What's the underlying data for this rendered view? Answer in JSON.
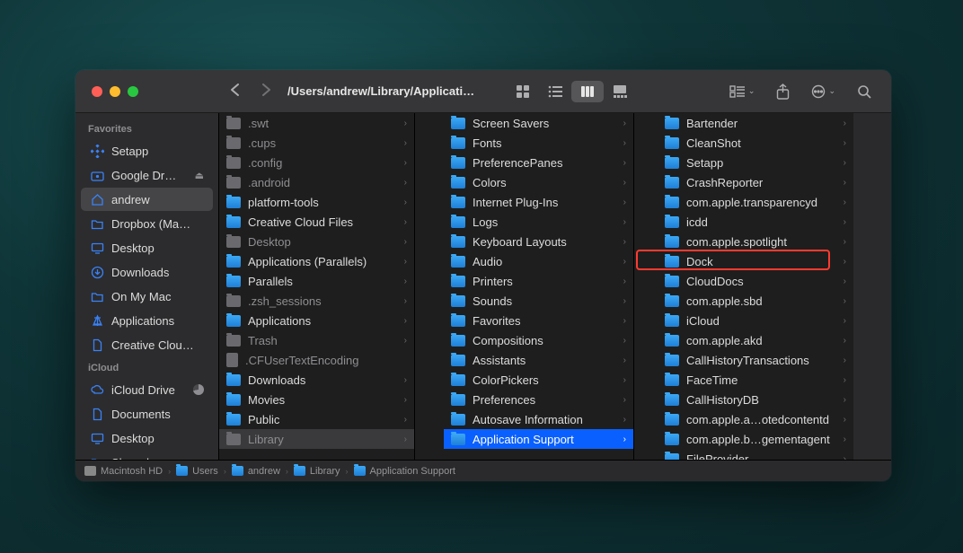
{
  "window": {
    "title": "/Users/andrew/Library/Applicati…"
  },
  "sidebar": {
    "section_favorites": "Favorites",
    "section_icloud": "iCloud",
    "favorites": [
      {
        "label": "Setapp",
        "icon": "setapp"
      },
      {
        "label": "Google Dr…",
        "icon": "drive",
        "eject": true
      },
      {
        "label": "andrew",
        "icon": "home",
        "active": true
      },
      {
        "label": "Dropbox (Ma…",
        "icon": "folder"
      },
      {
        "label": "Desktop",
        "icon": "desktop"
      },
      {
        "label": "Downloads",
        "icon": "downloads"
      },
      {
        "label": "On My Mac",
        "icon": "folder"
      },
      {
        "label": "Applications",
        "icon": "apps"
      },
      {
        "label": "Creative Clou…",
        "icon": "doc"
      }
    ],
    "icloud": [
      {
        "label": "iCloud Drive",
        "icon": "cloud",
        "pie": true
      },
      {
        "label": "Documents",
        "icon": "doc"
      },
      {
        "label": "Desktop",
        "icon": "desktop"
      },
      {
        "label": "Shared",
        "icon": "shared"
      }
    ]
  },
  "col1": [
    {
      "label": ".swt",
      "dim": true
    },
    {
      "label": ".cups",
      "dim": true
    },
    {
      "label": ".config",
      "dim": true
    },
    {
      "label": ".android",
      "dim": true
    },
    {
      "label": "platform-tools"
    },
    {
      "label": "Creative Cloud Files"
    },
    {
      "label": "Desktop",
      "dim": true
    },
    {
      "label": "Applications (Parallels)"
    },
    {
      "label": "Parallels"
    },
    {
      "label": ".zsh_sessions",
      "dim": true
    },
    {
      "label": "Applications"
    },
    {
      "label": "Trash",
      "dim": true
    },
    {
      "label": ".CFUserTextEncoding",
      "dim": true,
      "file": true
    },
    {
      "label": "Downloads"
    },
    {
      "label": "Movies"
    },
    {
      "label": "Public"
    },
    {
      "label": "Library",
      "dim": true,
      "sel": "grey"
    }
  ],
  "col2": [
    {
      "label": "Screen Savers"
    },
    {
      "label": "Fonts"
    },
    {
      "label": "PreferencePanes"
    },
    {
      "label": "Colors"
    },
    {
      "label": "Internet Plug-Ins"
    },
    {
      "label": "Logs"
    },
    {
      "label": "Keyboard Layouts"
    },
    {
      "label": "Audio"
    },
    {
      "label": "Printers"
    },
    {
      "label": "Sounds"
    },
    {
      "label": "Favorites"
    },
    {
      "label": "Compositions"
    },
    {
      "label": "Assistants"
    },
    {
      "label": "ColorPickers"
    },
    {
      "label": "Preferences"
    },
    {
      "label": "Autosave Information"
    },
    {
      "label": "Application Support",
      "sel": "blue"
    }
  ],
  "col3": [
    {
      "label": "Bartender"
    },
    {
      "label": "CleanShot"
    },
    {
      "label": "Setapp"
    },
    {
      "label": "CrashReporter"
    },
    {
      "label": "com.apple.transparencyd"
    },
    {
      "label": "icdd"
    },
    {
      "label": "com.apple.spotlight"
    },
    {
      "label": "Dock",
      "highlight": true
    },
    {
      "label": "CloudDocs"
    },
    {
      "label": "com.apple.sbd"
    },
    {
      "label": "iCloud"
    },
    {
      "label": "com.apple.akd"
    },
    {
      "label": "CallHistoryTransactions"
    },
    {
      "label": "FaceTime"
    },
    {
      "label": "CallHistoryDB"
    },
    {
      "label": "com.apple.a…otedcontentd"
    },
    {
      "label": "com.apple.b…gementagent"
    },
    {
      "label": "FileProvider"
    }
  ],
  "pathbar": [
    {
      "label": "Macintosh HD",
      "disk": true
    },
    {
      "label": "Users"
    },
    {
      "label": "andrew"
    },
    {
      "label": "Library"
    },
    {
      "label": "Application Support"
    }
  ]
}
